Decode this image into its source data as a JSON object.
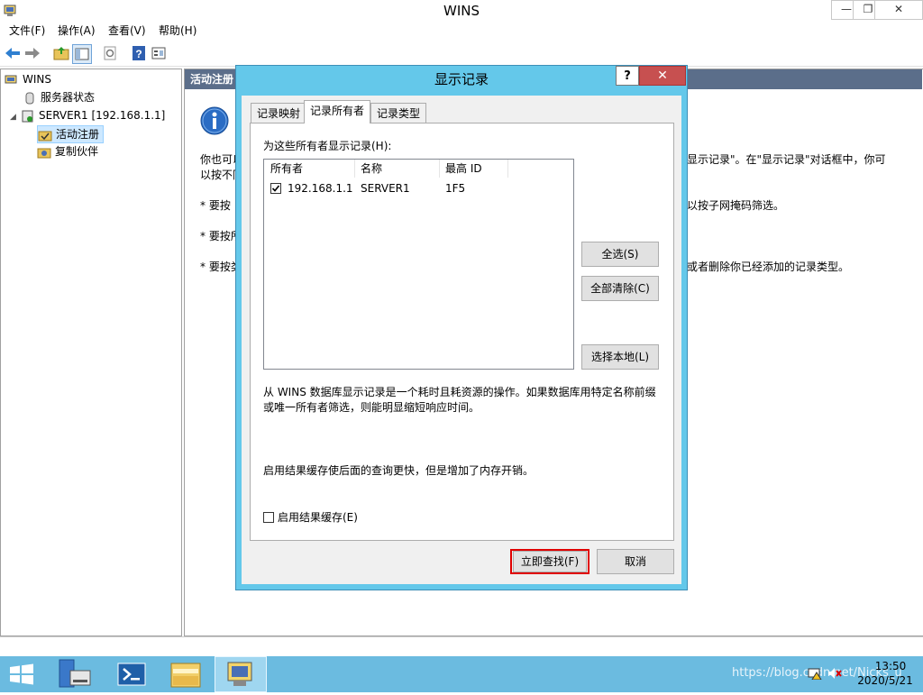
{
  "window": {
    "title": "WINS",
    "minimize": "—",
    "restore": "❐",
    "close": "✕"
  },
  "menu": [
    "文件(F)",
    "操作(A)",
    "查看(V)",
    "帮助(H)"
  ],
  "tree": {
    "root": "WINS",
    "server_status": "服务器状态",
    "server": "SERVER1 [192.168.1.1]",
    "active_registrations": "活动注册",
    "replication_partners": "复制伙伴"
  },
  "pane": {
    "header": "活动注册",
    "line1_start": "你也可以",
    "line1_end": "显示记录\"。在\"显示记录\"对话框中，你可",
    "line2_start": "以按不同",
    "bullet1_start": "* 要按",
    "bullet1_end": "以按子网掩码筛选。",
    "bullet2_start": "* 要按所",
    "bullet3_start": "* 要按类",
    "bullet3_end": "或者删除你已经添加的记录类型。"
  },
  "dialog": {
    "title": "显示记录",
    "help": "?",
    "close": "✕",
    "tabs": [
      "记录映射",
      "记录所有者",
      "记录类型"
    ],
    "owners_label": "为这些所有者显示记录(H):",
    "columns": [
      "所有者",
      "名称",
      "最高 ID"
    ],
    "rows": [
      {
        "owner": "192.168.1.1",
        "name": "SERVER1",
        "max_id": "1F5",
        "checked": "☑"
      }
    ],
    "select_all": "全选(S)",
    "clear_all": "全部清除(C)",
    "select_local": "选择本地(L)",
    "info_line1": "从 WINS 数据库显示记录是一个耗时且耗资源的操作。如果数据库用特定名称前缀",
    "info_line2": "或唯一所有者筛选，则能明显缩短响应时间。",
    "cache_info": "启用结果缓存使后面的查询更快，但是增加了内存开销。",
    "enable_cache": "启用结果缓存(E)",
    "find_now": "立即查找(F)",
    "cancel": "取消"
  },
  "taskbar": {
    "time": "13:50",
    "date": "2020/5/21",
    "watermark": "https://blog.csdn.net/Nicks_u"
  },
  "colors": {
    "dialog_frame": "#64c8ea",
    "taskbar": "#6bbbe0",
    "highlight": "#e00000"
  }
}
